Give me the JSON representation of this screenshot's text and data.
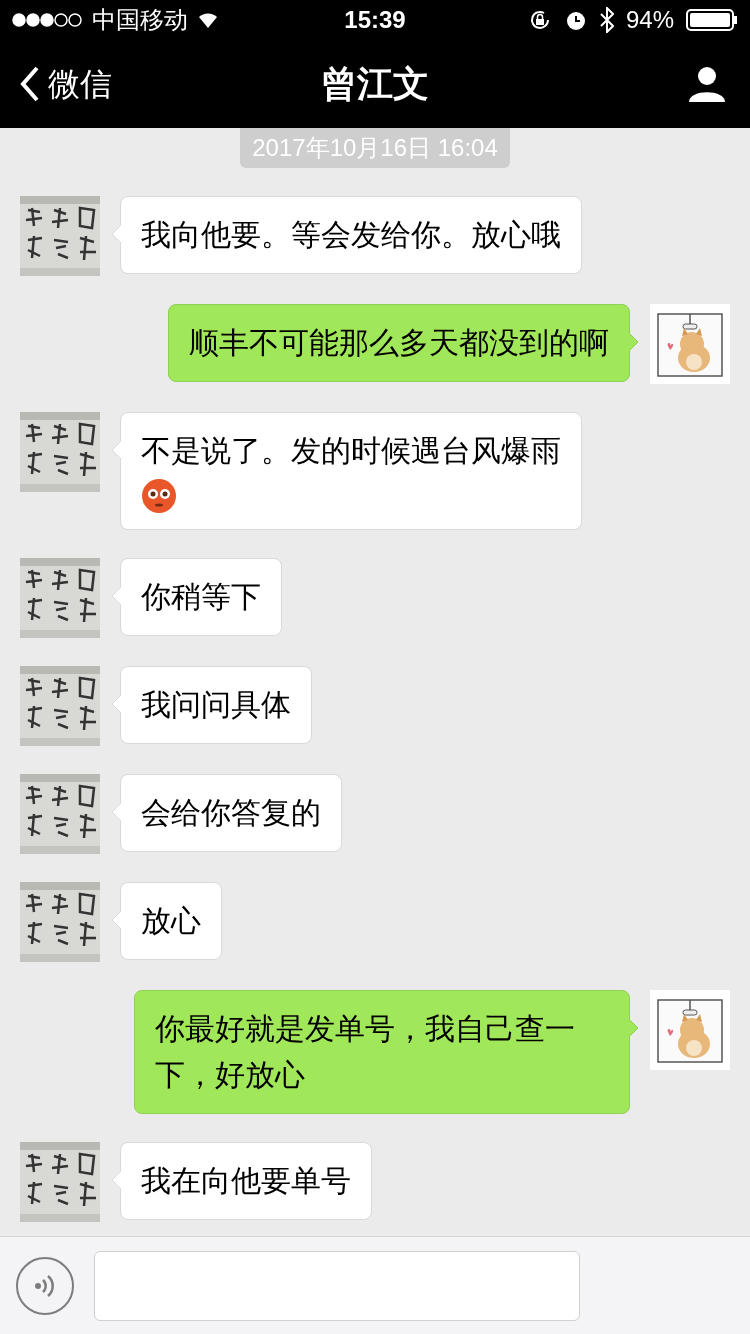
{
  "status_bar": {
    "carrier": "中国移动",
    "time": "15:39",
    "battery": "94%"
  },
  "nav": {
    "back": "微信",
    "title": "曾江文"
  },
  "timestamp": "2017年10月16日 16:04",
  "messages": [
    {
      "kind": "left",
      "text": "我向他要。等会发给你。放心哦"
    },
    {
      "kind": "right",
      "text": "顺丰不可能那么多天都没到的啊"
    },
    {
      "kind": "left",
      "text": "不是说了。发的时候遇台风爆雨",
      "emoji": true
    },
    {
      "kind": "left",
      "text": "你稍等下"
    },
    {
      "kind": "left",
      "text": "我问问具体"
    },
    {
      "kind": "left",
      "text": "会给你答复的"
    },
    {
      "kind": "left",
      "text": "放心"
    },
    {
      "kind": "right",
      "text": "你最好就是发单号，我自己查一下，好放心"
    },
    {
      "kind": "left",
      "text": "我在向他要单号"
    }
  ]
}
